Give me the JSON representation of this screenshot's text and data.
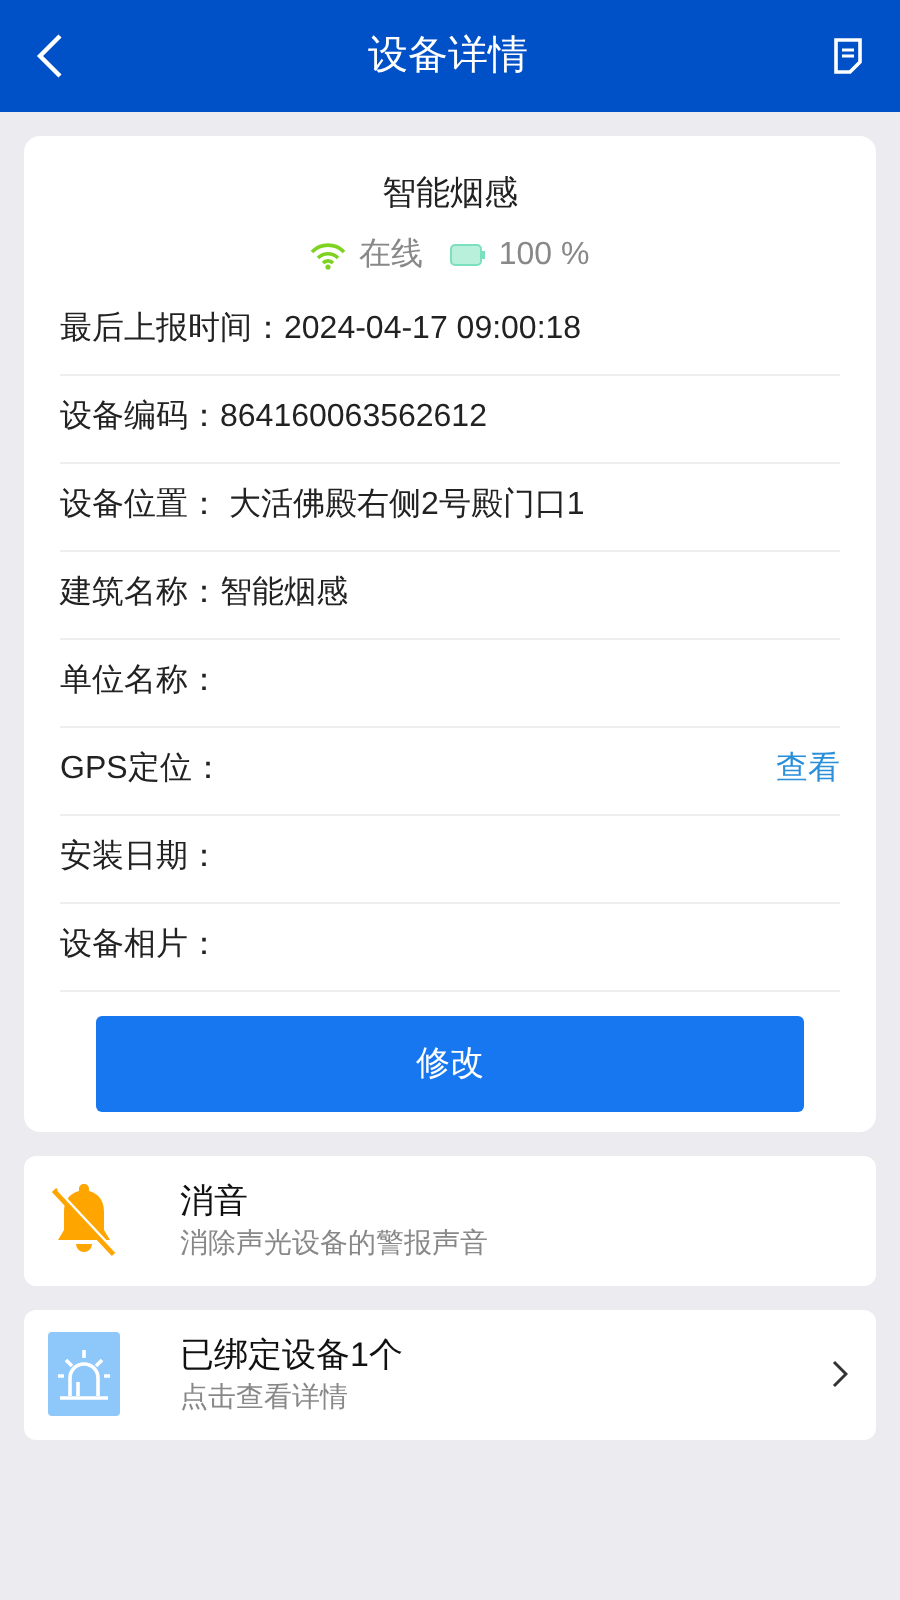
{
  "header": {
    "title": "设备详情"
  },
  "device": {
    "name": "智能烟感",
    "status": "在线",
    "battery": "100 %"
  },
  "fields": [
    {
      "label": "最后上报时间：",
      "value": "2024-04-17 09:00:18"
    },
    {
      "label": "设备编码：",
      "value": "864160063562612"
    },
    {
      "label": "设备位置：",
      "value": " 大活佛殿右侧2号殿门口1"
    },
    {
      "label": "建筑名称：",
      "value": "智能烟感"
    },
    {
      "label": "单位名称："
    },
    {
      "label": "GPS定位：",
      "action": "查看"
    },
    {
      "label": "安装日期："
    },
    {
      "label": "设备相片："
    }
  ],
  "edit_button": "修改",
  "actions": [
    {
      "kind": "mute",
      "title": "消音",
      "subtitle": "消除声光设备的警报声音"
    },
    {
      "kind": "bound",
      "title": "已绑定设备1个",
      "subtitle": "点击查看详情"
    }
  ]
}
